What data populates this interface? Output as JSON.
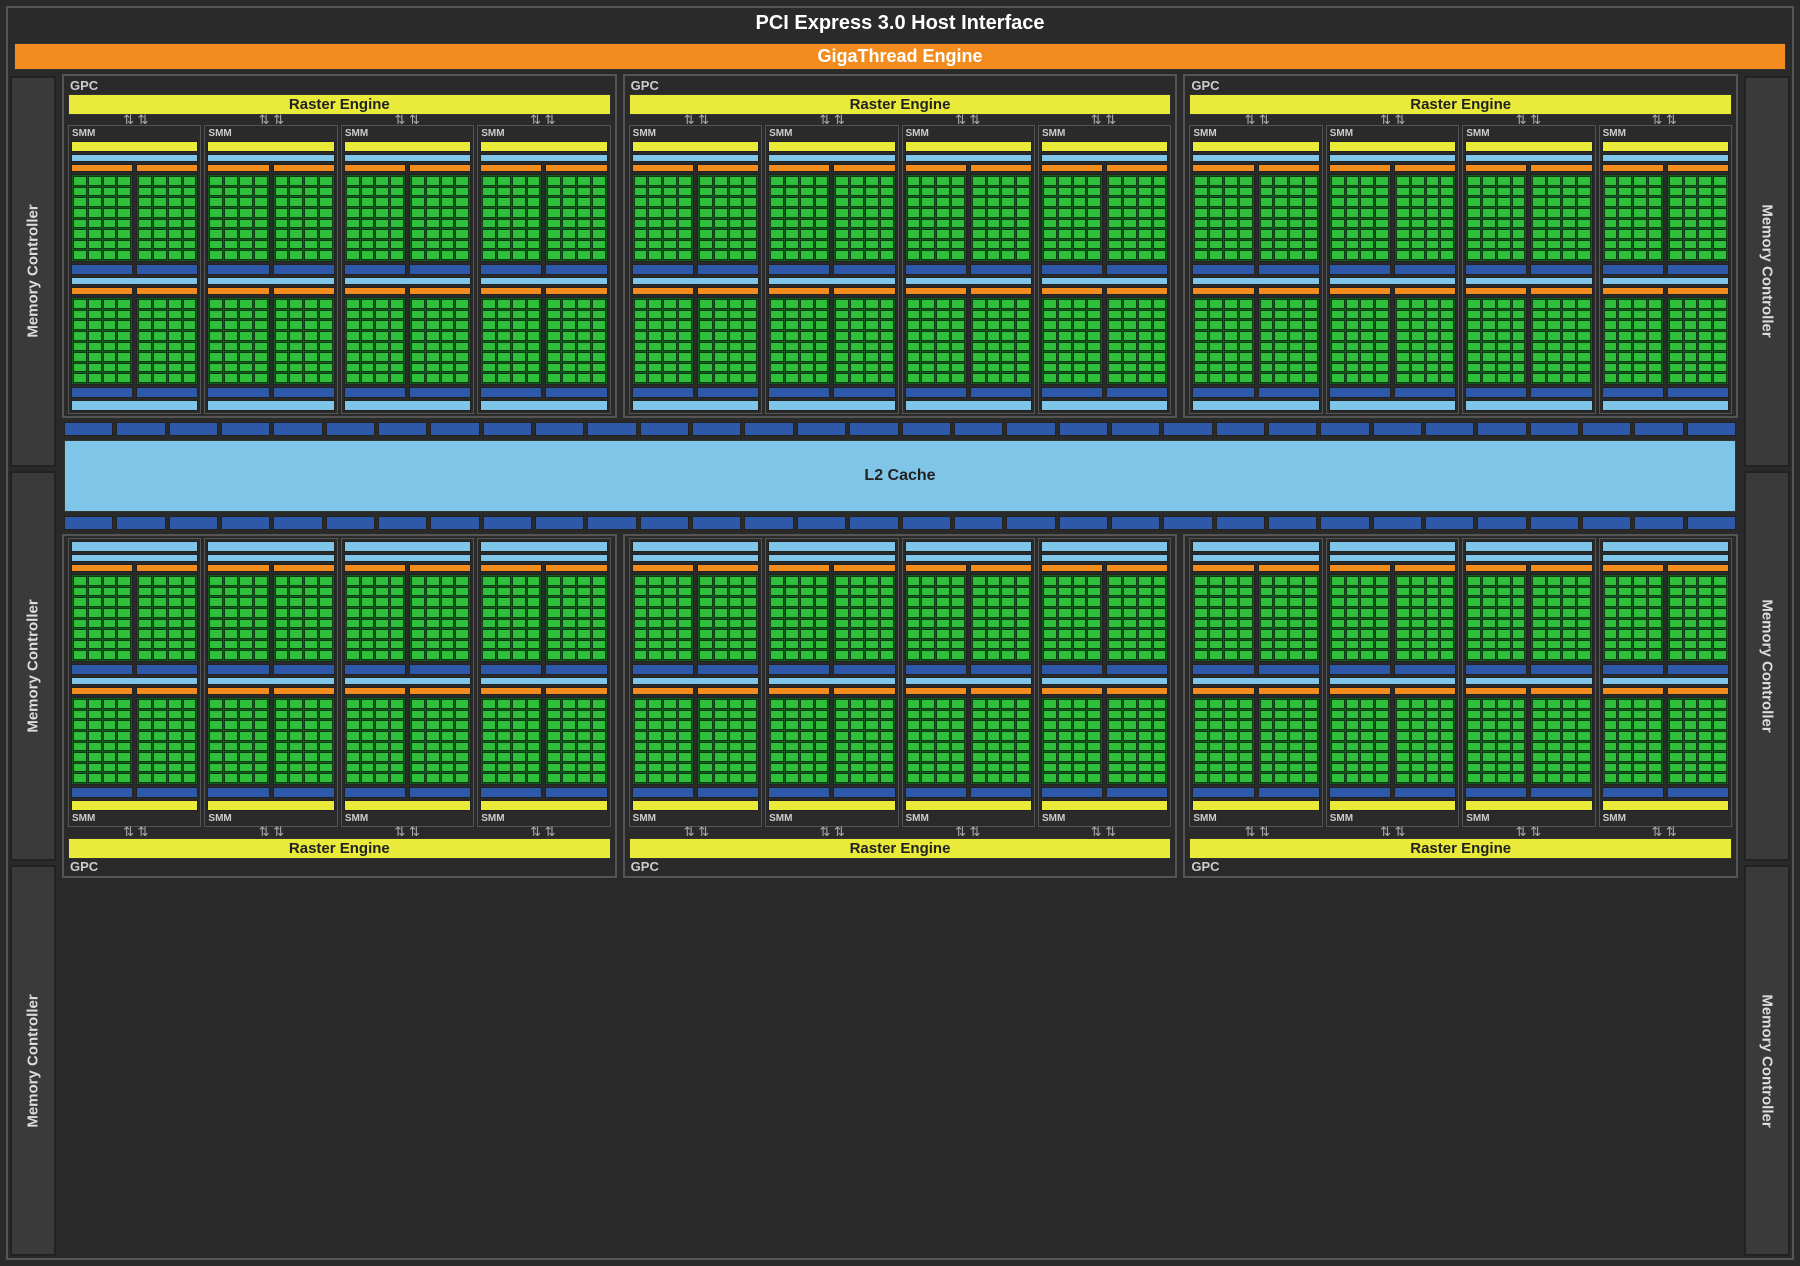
{
  "labels": {
    "pci": "PCI Express 3.0 Host Interface",
    "gigathread": "GigaThread Engine",
    "memctrl": "Memory Controller",
    "gpc": "GPC",
    "raster": "Raster Engine",
    "smm": "SMM",
    "l2": "L2 Cache"
  },
  "structure": {
    "gpc_count_per_row": 3,
    "gpc_rows": 2,
    "smm_per_gpc": 4,
    "memory_controllers_per_side": 3,
    "cores_per_grid_columns": 4,
    "cores_per_grid_rows": 8,
    "l2_strip_segments": 32
  },
  "colors": {
    "background": "#2a2a2a",
    "yellow": "#eaea3a",
    "orange": "#f28c1e",
    "lightblue": "#7fc5e8",
    "darkblue": "#2e59a8",
    "green_core": "#2fbf3a",
    "green_core_bg": "#155b1f"
  }
}
